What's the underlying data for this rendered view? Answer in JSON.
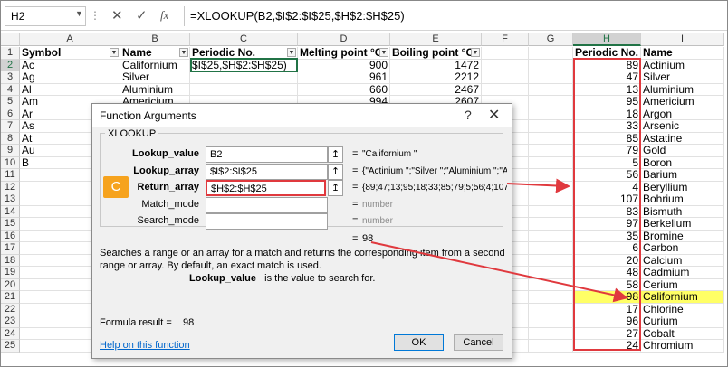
{
  "formula_bar": {
    "name_box": "H2",
    "cancel_icon": "✕",
    "enter_icon": "✓",
    "fx_icon": "fx",
    "formula": "=XLOOKUP(B2,$I$2:$I$25,$H$2:$H$25)"
  },
  "columns": [
    "A",
    "B",
    "C",
    "D",
    "E",
    "F",
    "G",
    "H",
    "I"
  ],
  "rows": [
    "1",
    "2",
    "3",
    "4",
    "5",
    "6",
    "7",
    "8",
    "9",
    "10",
    "11",
    "12",
    "13",
    "14",
    "15",
    "16",
    "17",
    "18",
    "19",
    "20",
    "21",
    "22",
    "23",
    "24",
    "25"
  ],
  "table": {
    "headers": [
      "Symbol",
      "Name",
      "Periodic No.",
      "Melting point °C",
      "Boiling point °C"
    ],
    "rows": [
      [
        "Ac",
        "Californium",
        "$I$25,$H$2:$H$25)",
        "900",
        "1472"
      ],
      [
        "Ag",
        "Silver",
        "",
        "961",
        "2212"
      ],
      [
        "Al",
        "Aluminium",
        "",
        "660",
        "2467"
      ],
      [
        "Am",
        "Americium",
        "",
        "994",
        "2607"
      ],
      [
        "Ar",
        "",
        "",
        "",
        ""
      ],
      [
        "As",
        "",
        "",
        "",
        ""
      ],
      [
        "At",
        "",
        "",
        "",
        ""
      ],
      [
        "Au",
        "",
        "",
        "",
        ""
      ],
      [
        "B",
        "",
        "",
        "",
        ""
      ]
    ]
  },
  "lookup": {
    "headers": [
      "Periodic No.",
      "Name"
    ],
    "rows": [
      [
        "89",
        "Actinium"
      ],
      [
        "47",
        "Silver"
      ],
      [
        "13",
        "Aluminium"
      ],
      [
        "95",
        "Americium"
      ],
      [
        "18",
        "Argon"
      ],
      [
        "33",
        "Arsenic"
      ],
      [
        "85",
        "Astatine"
      ],
      [
        "79",
        "Gold"
      ],
      [
        "5",
        "Boron"
      ],
      [
        "56",
        "Barium"
      ],
      [
        "4",
        "Beryllium"
      ],
      [
        "107",
        "Bohrium"
      ],
      [
        "83",
        "Bismuth"
      ],
      [
        "97",
        "Berkelium"
      ],
      [
        "35",
        "Bromine"
      ],
      [
        "6",
        "Carbon"
      ],
      [
        "20",
        "Calcium"
      ],
      [
        "48",
        "Cadmium"
      ],
      [
        "58",
        "Cerium"
      ],
      [
        "98",
        "Californium"
      ],
      [
        "17",
        "Chlorine"
      ],
      [
        "96",
        "Curium"
      ],
      [
        "27",
        "Cobalt"
      ],
      [
        "24",
        "Chromium"
      ]
    ],
    "highlight_row": 19
  },
  "dialog": {
    "title": "Function Arguments",
    "help_icon": "?",
    "close_icon": "✕",
    "function_name": "XLOOKUP",
    "badge": "C",
    "args": [
      {
        "label": "Lookup_value",
        "value": "B2",
        "result": "\"Californium \"",
        "bold": true
      },
      {
        "label": "Lookup_array",
        "value": "$I$2:$I$25",
        "result": "{\"Actinium \";\"Silver \";\"Aluminium \";\"A...",
        "bold": true
      },
      {
        "label": "Return_array",
        "value": "$H$2:$H$25",
        "result": "{89;47;13;95;18;33;85;79;5;56;4;107;83;...",
        "bold": true
      },
      {
        "label": "Match_mode",
        "value": "",
        "result": "number",
        "bold": false
      },
      {
        "label": "Search_mode",
        "value": "",
        "result": "number",
        "bold": false
      }
    ],
    "ref_icon": "↥",
    "equals": "=",
    "result": "98",
    "description": "Searches a range or an array for a match and returns the corresponding item from a second range or array. By default, an exact match is used.",
    "arg_desc_name": "Lookup_value",
    "arg_desc_text": "is the value to search for.",
    "formula_result_label": "Formula result =",
    "formula_result_value": "98",
    "help_link": "Help on this function",
    "ok_label": "OK",
    "cancel_label": "Cancel"
  },
  "colors": {
    "accent_green": "#217346",
    "annotation_red": "#e0393e",
    "highlight_yellow": "#ffff66",
    "badge_orange": "#f6a31e"
  }
}
